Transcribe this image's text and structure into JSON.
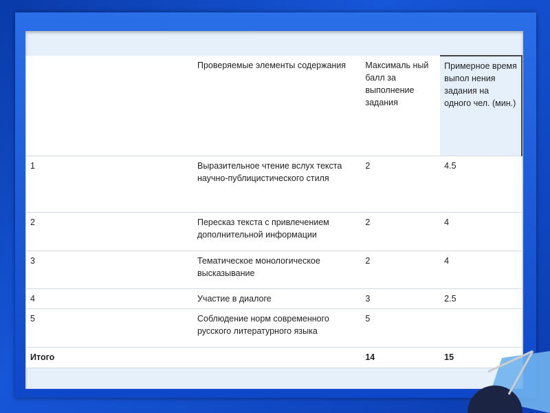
{
  "table": {
    "header": [
      "",
      "Проверяемые элементы содержания",
      "Максималь ный балл за выполнение задания",
      "Примерное время выпол нения задания на одного чел. (мин.)"
    ],
    "rows": [
      [
        "1",
        "Выразительное чтение вслух текста научно-публицистического стиля",
        "2",
        "4.5"
      ],
      [
        "2",
        "Пересказ текста с привлечением дополнительной информации",
        "2",
        "4"
      ],
      [
        "3",
        "Тематическое монологическое высказывание",
        "2",
        "4"
      ],
      [
        "4",
        "Участие в диалоге",
        "3",
        "2.5"
      ],
      [
        "5",
        "Соблюдение норм современного русского литературного языка",
        "5",
        ""
      ]
    ],
    "total": [
      "Итого",
      "",
      "14",
      "15"
    ]
  }
}
